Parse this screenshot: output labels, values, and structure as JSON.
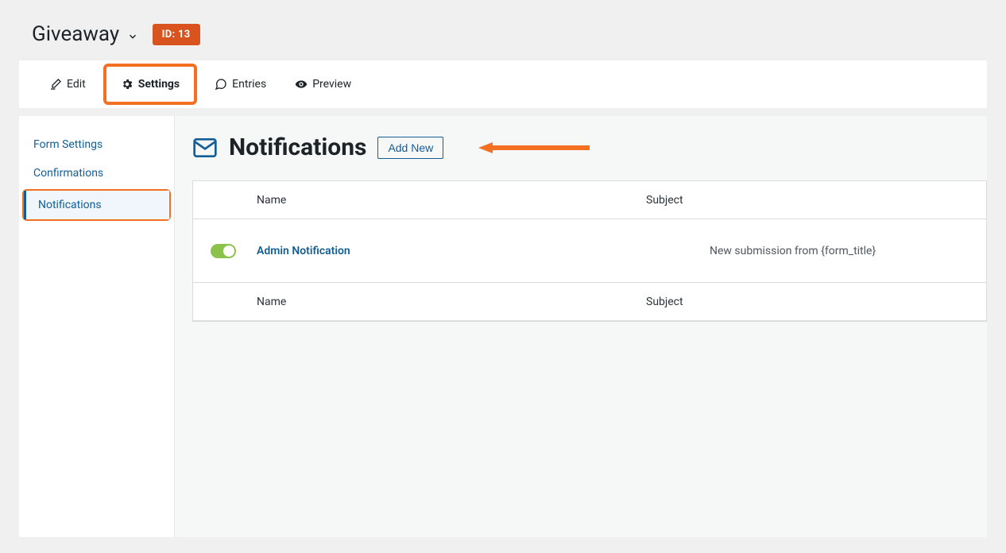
{
  "header": {
    "form_title": "Giveaway",
    "id_badge": "ID: 13"
  },
  "tabs": {
    "edit": "Edit",
    "settings": "Settings",
    "entries": "Entries",
    "preview": "Preview"
  },
  "sidebar": {
    "form_settings": "Form Settings",
    "confirmations": "Confirmations",
    "notifications": "Notifications"
  },
  "page": {
    "title": "Notifications",
    "add_new": "Add New"
  },
  "table": {
    "col_name": "Name",
    "col_subject": "Subject",
    "rows": [
      {
        "enabled": true,
        "name": "Admin Notification",
        "subject": "New submission from {form_title}"
      }
    ]
  }
}
